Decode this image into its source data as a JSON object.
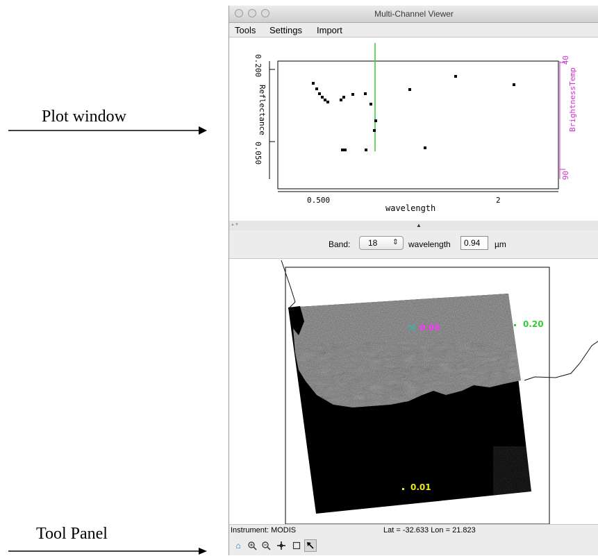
{
  "annotations": {
    "plot_window": "Plot window",
    "tool_panel": "Tool Panel"
  },
  "window": {
    "title": "Multi-Channel Viewer"
  },
  "menu": {
    "tools": "Tools",
    "settings": "Settings",
    "import": "Import"
  },
  "plot": {
    "y_label": "Reflectance",
    "y_tick_top": "0.200",
    "y_tick_bottom": "0.050",
    "x_label": "wavelength",
    "x_tick_1": "0.500",
    "x_tick_2": "2",
    "y2_label": "BrightnessTemp",
    "y2_tick_top": "40",
    "y2_tick_bottom": "90"
  },
  "band": {
    "label": "Band:",
    "value": "18",
    "wavelength_label": "wavelength",
    "wavelength_value": "0.94",
    "unit": "µm"
  },
  "map": {
    "marker_magenta": "0.05",
    "marker_green": "0.20",
    "marker_yellow": "0.01",
    "colors": {
      "magenta": "#ff33ff",
      "green": "#33cc33",
      "yellow": "#e8e81e",
      "cursor": "#2fb8a6"
    }
  },
  "status": {
    "instrument": "Instrument: MODIS",
    "latlon": "Lat = -32.633  Lon = 21.823"
  },
  "tools": {
    "home": "home-icon",
    "zoom_in": "zoom-in-icon",
    "zoom_out": "zoom-out-icon",
    "pan": "pan-icon",
    "select_box": "select-box-icon",
    "pointer": "pointer-icon"
  },
  "colors": {
    "cursor_line": "#33cc33",
    "secondary_axis": "#cc33cc"
  }
}
